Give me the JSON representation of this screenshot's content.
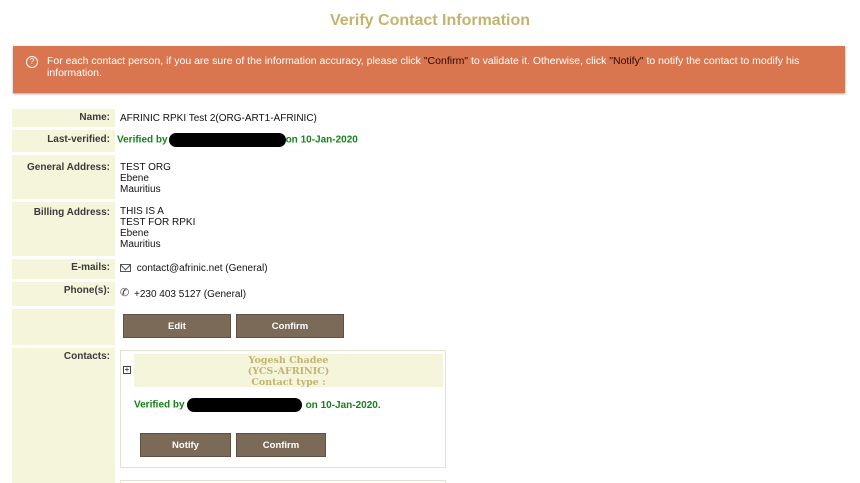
{
  "page": {
    "title": "Verify Contact Information"
  },
  "banner": {
    "text_1": "For each contact person, if you are sure of the information accuracy, please click ",
    "confirm_word": "\"Confirm\"",
    "text_2": " to validate it. Otherwise, click ",
    "notify_word": "\"Notify\"",
    "text_3": " to notify the contact to modify his information.",
    "icon": "question-circle-icon"
  },
  "organization": {
    "name_label": "Name:",
    "name_value": "AFRINIC RPKI Test 2(ORG-ART1-AFRINIC)",
    "last_verified_label": "Last-verified:",
    "verified_prefix": "Verified by",
    "verified_suffix": "on 10-Jan-2020",
    "general_address_label": "General Address:",
    "general_address": [
      "TEST ORG",
      "Ebene",
      "Mauritius"
    ],
    "billing_address_label": "Billing Address:",
    "billing_address": [
      "THIS IS A",
      "TEST FOR RPKI",
      "Ebene",
      "Mauritius"
    ],
    "emails_label": "E-mails:",
    "email_value": "contact@afrinic.net (General)",
    "phones_label": "Phone(s):",
    "phone_value": "+230 403 5127 (General)",
    "edit_label": "Edit",
    "confirm_label": "Confirm"
  },
  "contacts": {
    "label": "Contacts:",
    "items": [
      {
        "name": "Yogesh Chadee",
        "handle": "(YCS-AFRINIC)",
        "contact_type": "Contact type :",
        "verified_prefix": "Verified by",
        "verified_suffix": "on 10-Jan-2020.",
        "notify_label": "Notify",
        "confirm_label": "Confirm"
      }
    ]
  },
  "colors": {
    "title": "#c2b46f",
    "banner": "#d9764f",
    "label_bg": "#f5f5dc",
    "button": "#7b6a58",
    "verified_green": "#16821a"
  }
}
